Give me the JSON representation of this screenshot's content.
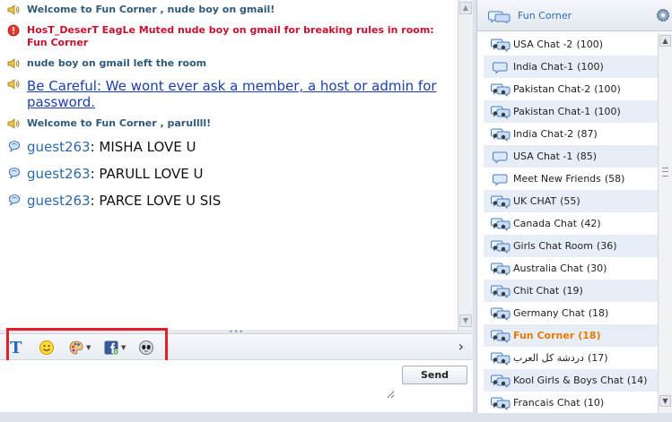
{
  "messages": [
    {
      "type": "sys",
      "icon": "speaker-icon",
      "text": "Welcome to Fun Corner , nude boy on gmail!"
    },
    {
      "type": "alert",
      "icon": "warning-icon",
      "text": "HosT_DeserT EagLe Muted nude boy on gmail for breaking rules in room: Fun Corner"
    },
    {
      "type": "sys",
      "icon": "speaker-icon",
      "text": "nude boy on gmail left the room"
    },
    {
      "type": "notice",
      "icon": "speaker-icon",
      "text": "Be Careful: We wont ever ask a member, a host or admin for password."
    },
    {
      "type": "sys",
      "icon": "speaker-icon",
      "text": "Welcome to Fun Corner , parullll!"
    },
    {
      "type": "user",
      "icon": "chat-bubble-icon",
      "nick": "guest263",
      "text": "MISHA LOVE U"
    },
    {
      "type": "user",
      "icon": "chat-bubble-icon",
      "nick": "guest263",
      "text": "PARULL LOVE U"
    },
    {
      "type": "user",
      "icon": "chat-bubble-icon",
      "nick": "guest263",
      "text": "PARCE LOVE U SIS"
    }
  ],
  "toolbar": {
    "send_label": "Send",
    "input_value": ""
  },
  "room_header": {
    "title": "Fun Corner"
  },
  "rooms": [
    {
      "name": "USA Chat -2",
      "count": "(100)",
      "icon": "group-chat-icon",
      "active": false
    },
    {
      "name": "India Chat-1",
      "count": "(100)",
      "icon": "single-chat-icon",
      "active": false
    },
    {
      "name": "Pakistan Chat-2",
      "count": "(100)",
      "icon": "group-chat-icon",
      "active": false
    },
    {
      "name": "Pakistan Chat-1",
      "count": "(100)",
      "icon": "group-chat-icon",
      "active": false
    },
    {
      "name": "India Chat-2",
      "count": "(87)",
      "icon": "group-chat-icon",
      "active": false
    },
    {
      "name": "USA Chat -1",
      "count": "(85)",
      "icon": "single-chat-icon",
      "active": false
    },
    {
      "name": "Meet New Friends",
      "count": "(58)",
      "icon": "single-chat-icon",
      "active": false
    },
    {
      "name": "UK CHAT",
      "count": "(55)",
      "icon": "group-chat-icon",
      "active": false
    },
    {
      "name": "Canada Chat",
      "count": "(42)",
      "icon": "group-chat-icon",
      "active": false
    },
    {
      "name": "Girls Chat Room",
      "count": "(36)",
      "icon": "group-chat-icon",
      "active": false
    },
    {
      "name": "Australia Chat",
      "count": "(30)",
      "icon": "group-chat-icon",
      "active": false
    },
    {
      "name": "Chit Chat",
      "count": "(19)",
      "icon": "group-chat-icon",
      "active": false
    },
    {
      "name": "Germany Chat",
      "count": "(18)",
      "icon": "group-chat-icon",
      "active": false
    },
    {
      "name": "Fun Corner",
      "count": "(18)",
      "icon": "group-chat-icon",
      "active": true
    },
    {
      "name": "دردشة كل العرب",
      "count": "(17)",
      "icon": "group-chat-icon",
      "active": false
    },
    {
      "name": "Kool Girls & Boys Chat",
      "count": "(14)",
      "icon": "group-chat-icon",
      "active": false
    },
    {
      "name": "Francais Chat",
      "count": "(10)",
      "icon": "group-chat-icon",
      "active": false
    }
  ],
  "colors": {
    "accent": "#2f6fb0",
    "active_room": "#e57a00",
    "alert": "#c8102e",
    "highlight_box": "#e21f26"
  }
}
